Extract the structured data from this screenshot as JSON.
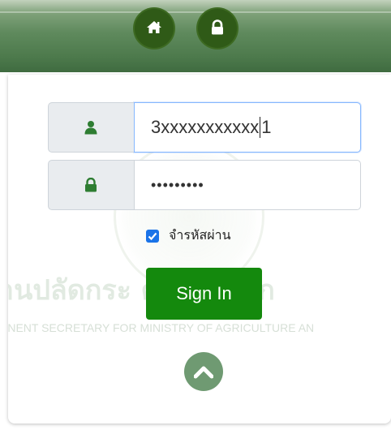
{
  "header": {
    "home_icon": "home-icon",
    "lock_icon": "lock-icon"
  },
  "login": {
    "username_icon": "user-icon",
    "username_before_caret": "3xxxxxxxxxxx",
    "username_after_caret": "1",
    "password_icon": "lock-icon",
    "password_masked": "•••••••••",
    "remember_label": "จำรหัสผ่าน",
    "remember_checked": true,
    "signin_label": "Sign In",
    "scroll_up_icon": "chevron-up-icon"
  },
  "watermark": {
    "thai_text": "านปลัดกระ          ตรและสหก",
    "english_text": "ANENT SECRETARY FOR MINISTRY OF AGRICULTURE AN"
  },
  "colors": {
    "header_green": "#4d7a4c",
    "icon_circle": "#2f5a17",
    "signin_green": "#14890d",
    "addon_icon_green": "#2e7d32",
    "checkbox_blue": "#1a73e8"
  }
}
